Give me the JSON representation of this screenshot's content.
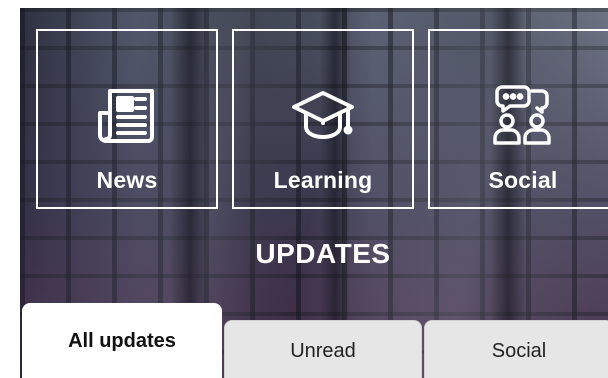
{
  "categories": [
    {
      "label": "News",
      "icon": "newspaper-icon"
    },
    {
      "label": "Learning",
      "icon": "graduation-cap-icon"
    },
    {
      "label": "Social",
      "icon": "people-chat-icon"
    }
  ],
  "section_title": "UPDATES",
  "tabs": [
    {
      "label": "All updates",
      "selected": true
    },
    {
      "label": "Unread",
      "selected": false
    },
    {
      "label": "Social",
      "selected": false
    }
  ],
  "colors": {
    "tile_border": "#ffffff",
    "text_on_hero": "#ffffff",
    "tab_active_bg": "#ffffff",
    "tab_inactive_bg": "#e6e6e6"
  }
}
